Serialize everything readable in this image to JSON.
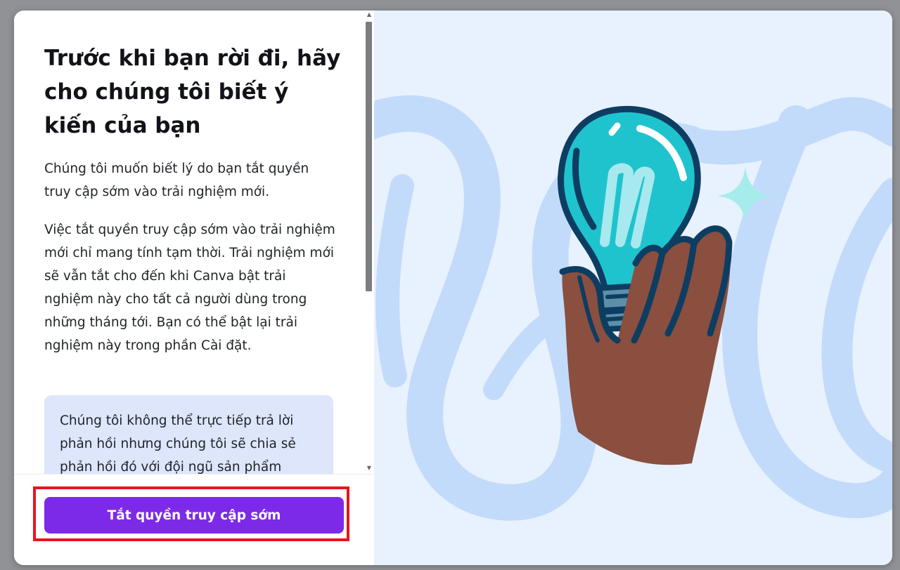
{
  "dialog": {
    "title": "Trước khi bạn rời đi, hãy cho chúng tôi biết ý kiến của bạn",
    "paragraph_1": "Chúng tôi muốn biết lý do bạn tắt quyền truy cập sớm vào trải nghiệm mới.",
    "paragraph_2": "Việc tắt quyền truy cập sớm vào trải nghiệm mới chỉ mang tính tạm thời. Trải nghiệm mới sẽ vẫn tắt cho đến khi Canva bật trải nghiệm này cho tất cả người dùng trong những tháng tới. Bạn có thể bật lại trải nghiệm này trong phần Cài đặt.",
    "info_note": "Chúng tôi không thể trực tiếp trả lời phản hồi nhưng chúng tôi sẽ chia sẻ phản hồi đó với đội ngũ sản phẩm",
    "primary_button_label": "Tắt quyền truy cập sớm"
  },
  "illustration": {
    "icon": "lightbulb-in-hand-illustration",
    "colors": {
      "background": "#e8f1fe",
      "scribble": "#c3dbfa",
      "bulb": "#1fc3ce",
      "outline": "#0e3d62",
      "hand": "#8a4f3f",
      "sparkle": "#a6ecec"
    }
  },
  "colors": {
    "accent": "#7d2ae8",
    "highlight": "#e8141d",
    "info_box": "#dde6fb"
  }
}
